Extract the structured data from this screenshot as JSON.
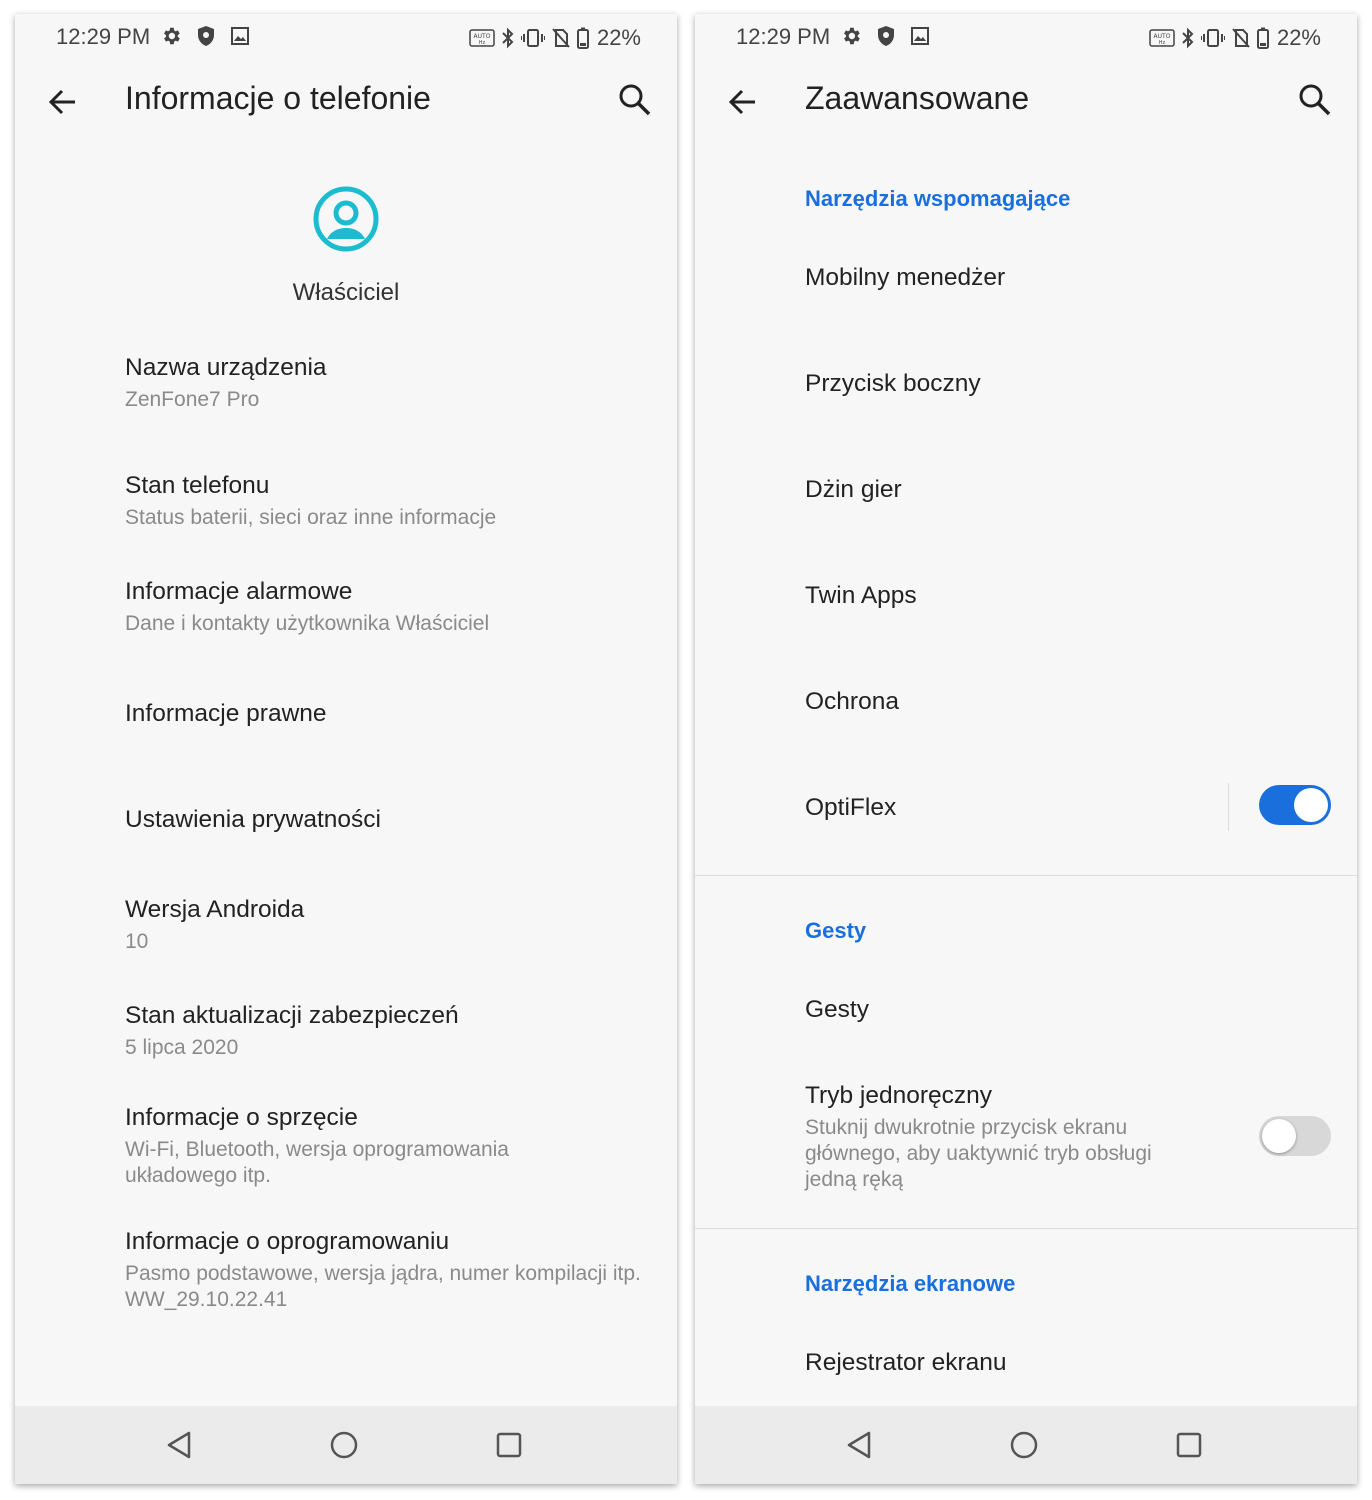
{
  "status_bar": {
    "time": "12:29 PM",
    "battery": "22%",
    "icons_left": [
      "settings-icon",
      "shield-icon",
      "image-icon"
    ],
    "icons_right": [
      "auto-hz-icon",
      "bluetooth-icon",
      "vibrate-icon",
      "no-sim-icon",
      "battery-icon"
    ]
  },
  "left": {
    "title": "Informacje o telefonie",
    "owner_name": "Właściciel",
    "items": [
      {
        "title": "Nazwa urządzenia",
        "subtitle": "ZenFone7 Pro"
      },
      {
        "title": "Stan telefonu",
        "subtitle": "Status baterii, sieci oraz inne informacje"
      },
      {
        "title": "Informacje alarmowe",
        "subtitle": "Dane i kontakty użytkownika Właściciel"
      },
      {
        "title": "Informacje prawne"
      },
      {
        "title": "Ustawienia prywatności"
      },
      {
        "title": "Wersja Androida",
        "subtitle": "10"
      },
      {
        "title": "Stan aktualizacji zabezpieczeń",
        "subtitle": "5 lipca 2020"
      },
      {
        "title": "Informacje o sprzęcie",
        "subtitle": "Wi-Fi, Bluetooth, wersja oprogramowania układowego itp."
      },
      {
        "title": "Informacje o oprogramowaniu",
        "subtitle": "Pasmo podstawowe, wersja jądra, numer kompilacji itp.",
        "subtitle2": "WW_29.10.22.41"
      }
    ]
  },
  "right": {
    "title": "Zaawansowane",
    "sections": [
      {
        "header": "Narzędzia wspomagające"
      },
      {
        "header": "Gesty"
      },
      {
        "header": "Narzędzia ekranowe"
      }
    ],
    "items": [
      {
        "title": "Mobilny menedżer"
      },
      {
        "title": "Przycisk boczny"
      },
      {
        "title": "Dżin gier"
      },
      {
        "title": "Twin Apps"
      },
      {
        "title": "Ochrona"
      },
      {
        "title": "OptiFlex",
        "toggle": true
      },
      {
        "title": "Gesty"
      },
      {
        "title": "Tryb jednoręczny",
        "subtitle": "Stuknij dwukrotnie przycisk ekranu głównego, aby uaktywnić tryb obsługi jedną ręką",
        "toggle": false
      },
      {
        "title": "Rejestrator ekranu"
      }
    ]
  },
  "colors": {
    "accent": "#1a6fdc",
    "avatar": "#1bbccf",
    "background": "#f7f7f7",
    "nav_bar": "#ebebeb"
  }
}
